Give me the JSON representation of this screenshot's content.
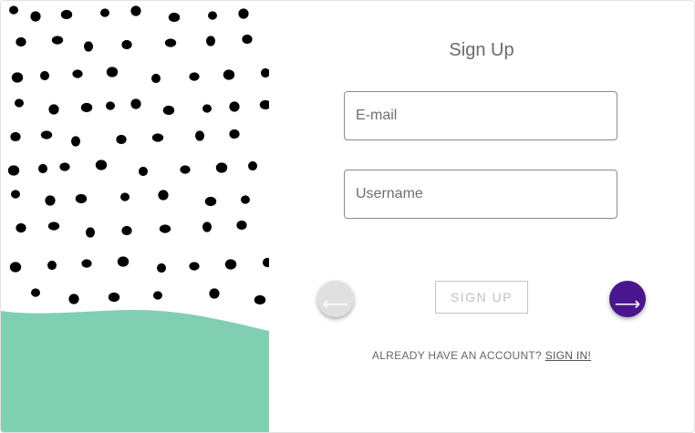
{
  "colors": {
    "mint": "#81cfb3",
    "dots": "#000000",
    "next_button": "#4a168f",
    "back_button": "#e0e0e0"
  },
  "form": {
    "title": "Sign Up",
    "email_placeholder": "E-mail",
    "username_placeholder": "Username",
    "submit_label": "SIGN UP"
  },
  "nav": {
    "back_icon": "arrow-left-icon",
    "back_glyph": "⟵",
    "next_icon": "arrow-right-icon",
    "next_glyph": "⟶"
  },
  "footer": {
    "prompt": "ALREADY HAVE AN ACCOUNT?",
    "link": "SIGN IN!"
  }
}
